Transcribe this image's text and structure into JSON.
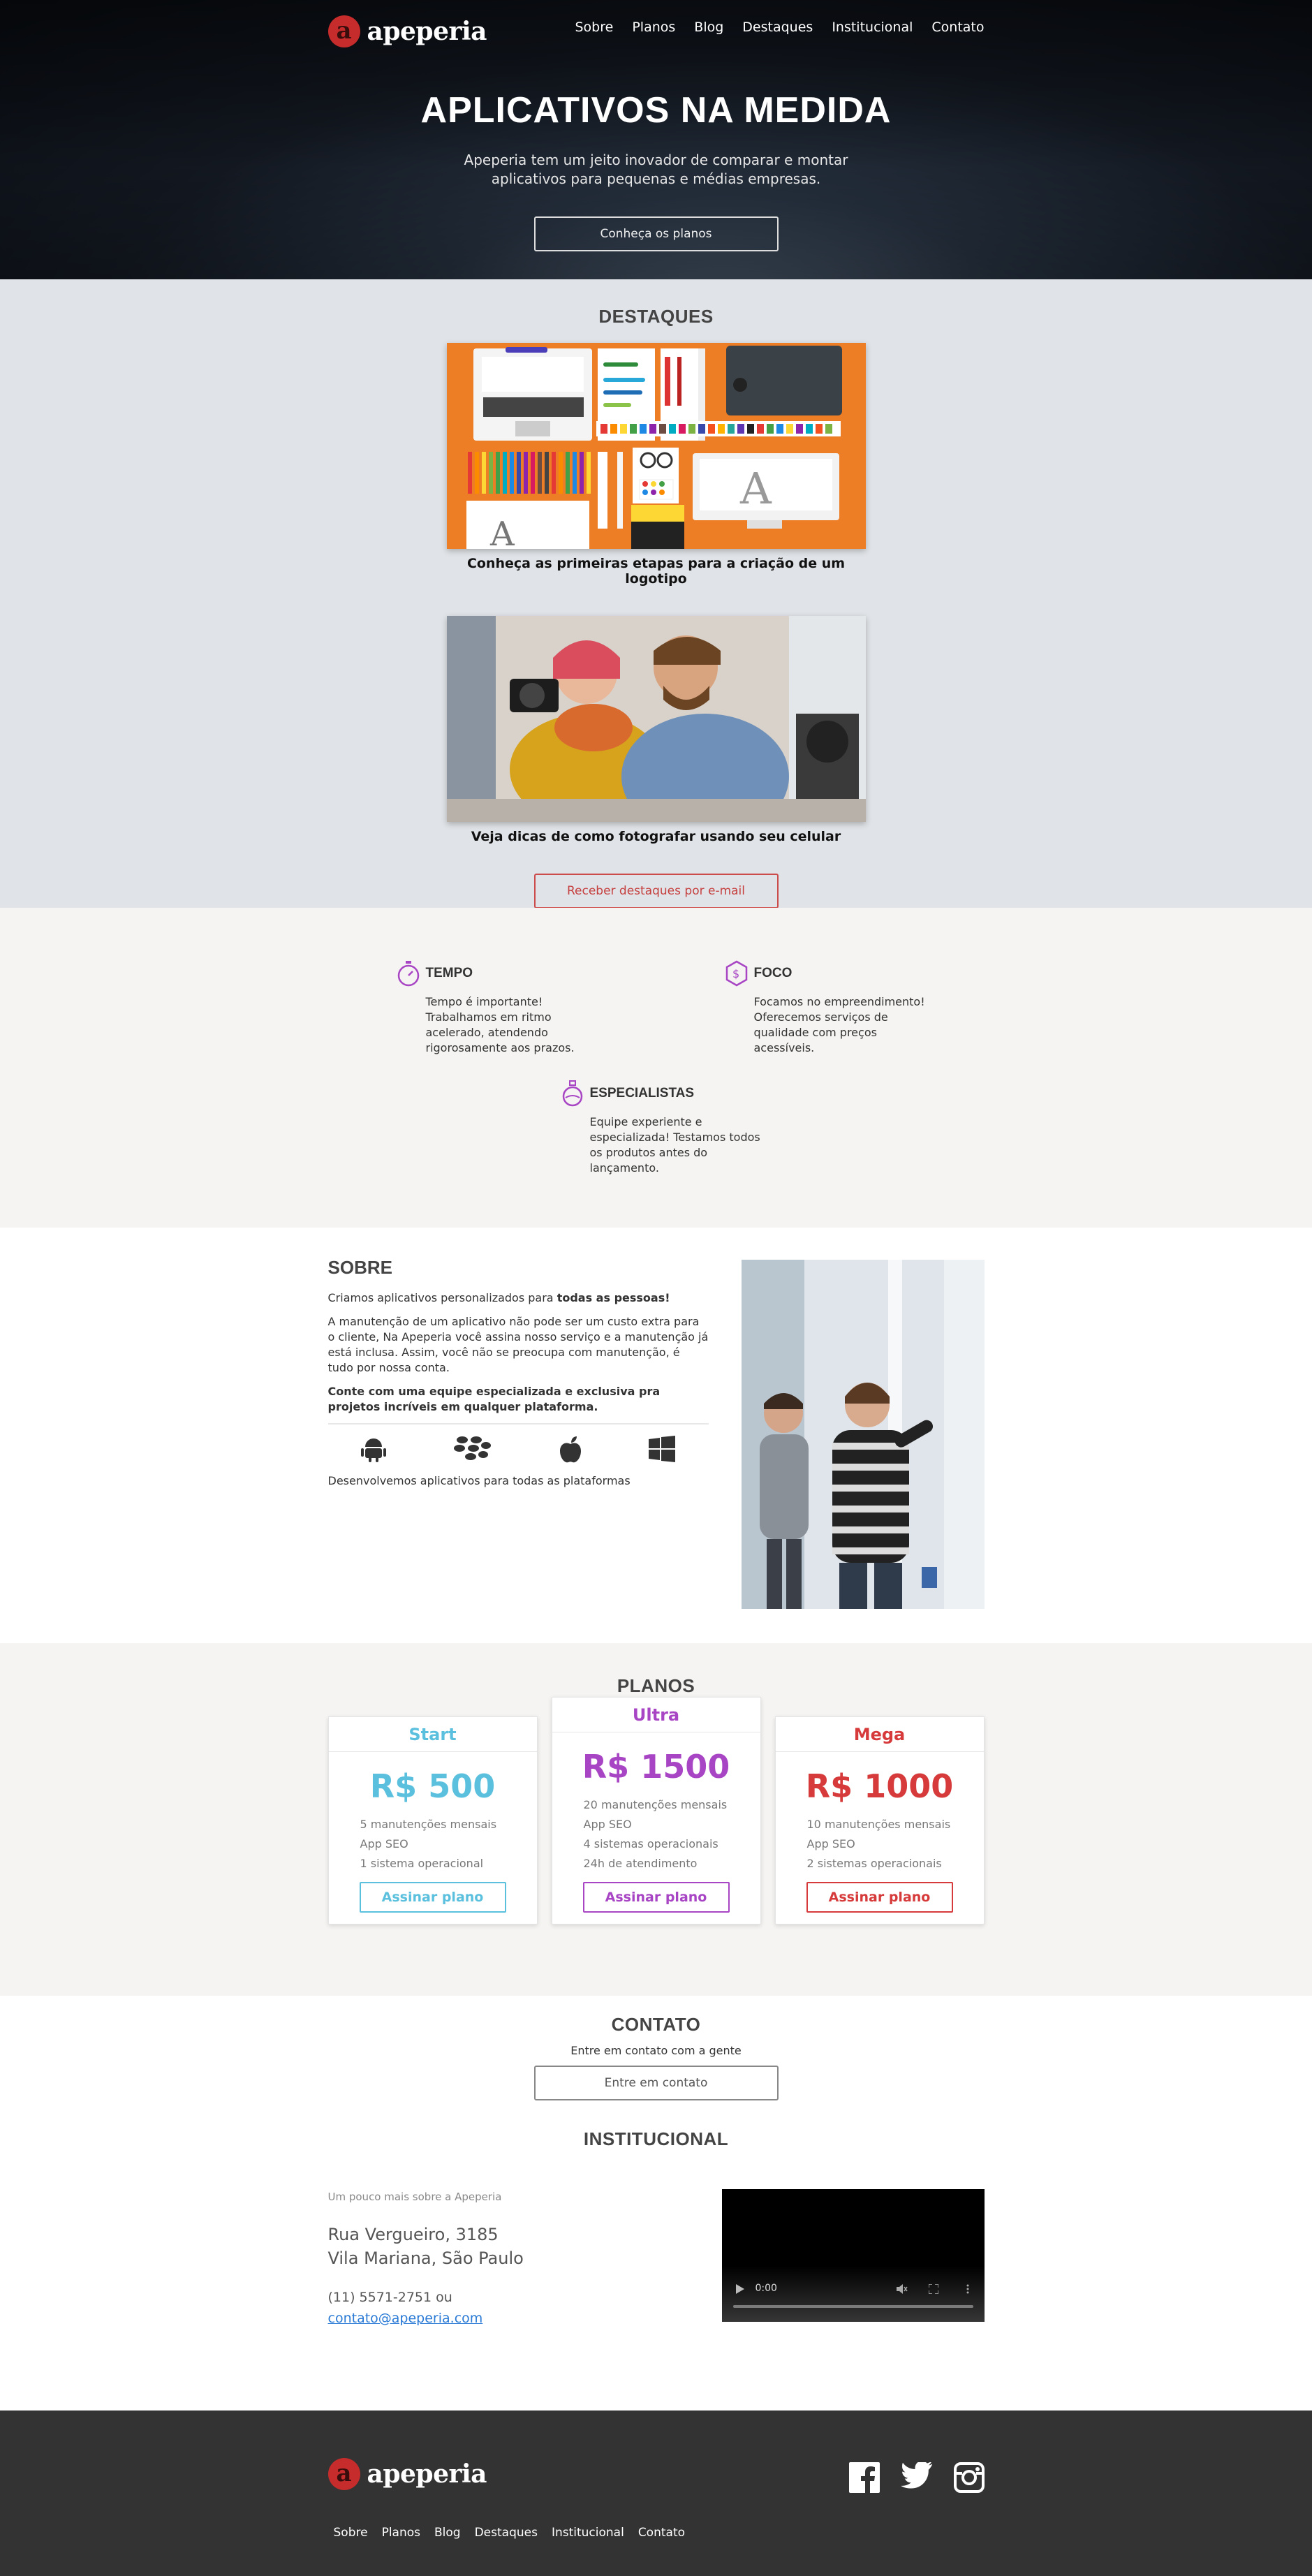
{
  "brand": {
    "logo_letter": "a",
    "name": "apeperia",
    "accent": "#c62c2c"
  },
  "nav": [
    "Sobre",
    "Planos",
    "Blog",
    "Destaques",
    "Institucional",
    "Contato"
  ],
  "hero": {
    "title": "APLICATIVOS NA MEDIDA",
    "subtitle": "Apeperia tem um jeito inovador de comparar e montar aplicativos para pequenas e médias empresas.",
    "button": "Conheça os planos"
  },
  "destaques": {
    "title": "DESTAQUES",
    "items": [
      {
        "caption": "Conheça as primeiras etapas para a criação de um logotipo"
      },
      {
        "caption": "Veja dicas de como fotografar usando seu celular"
      }
    ],
    "button": "Receber destaques por e-mail"
  },
  "features": [
    {
      "icon": "stopwatch-icon",
      "title": "TEMPO",
      "text": "Tempo é importante! Trabalhamos em ritmo acelerado, atendendo rigorosamente aos prazos."
    },
    {
      "icon": "dollar-hexagon-icon",
      "title": "FOCO",
      "text": "Focamos no empreendimento! Oferecemos serviços de qualidade com preços acessíveis."
    },
    {
      "icon": "flask-icon",
      "title": "ESPECIALISTAS",
      "text": "Equipe experiente e especializada! Testamos todos os produtos antes do lançamento."
    }
  ],
  "sobre": {
    "title": "SOBRE",
    "p1_start": "Criamos aplicativos personalizados para ",
    "p1_bold": "todas as pessoas!",
    "p2": "A manutenção de um aplicativo não pode ser um custo extra para o cliente, Na Apeperia você assina nosso serviço e a manutenção já está inclusa. Assim, você não se preocupa com manutenção, é tudo por nossa conta.",
    "p3": "Conte com uma equipe especializada e exclusiva pra projetos incríveis em qualquer plataforma.",
    "platforms": [
      "android-icon",
      "blackberry-icon",
      "apple-icon",
      "windows-icon"
    ],
    "platforms_text": "Desenvolvemos aplicativos para todas as plataformas"
  },
  "planos": {
    "title": "PLANOS",
    "plans": [
      {
        "name": "Start",
        "price": "R$ 500",
        "color": "#5bc0de",
        "features": [
          "5 manutenções mensais",
          "App SEO",
          "1 sistema operacional"
        ],
        "button": "Assinar plano"
      },
      {
        "name": "Ultra",
        "price": "R$ 1500",
        "color": "#a845c4",
        "features": [
          "20 manutenções mensais",
          "App SEO",
          "4 sistemas operacionais",
          "24h de atendimento"
        ],
        "button": "Assinar plano"
      },
      {
        "name": "Mega",
        "price": "R$ 1000",
        "color": "#d63a3a",
        "features": [
          "10 manutenções mensais",
          "App SEO",
          "2 sistemas operacionais"
        ],
        "button": "Assinar plano"
      }
    ]
  },
  "contato": {
    "title": "CONTATO",
    "text": "Entre em contato com a gente",
    "button": "Entre em contato"
  },
  "institucional": {
    "title": "INSTITUCIONAL",
    "intro": "Um pouco mais sobre a Apeperia",
    "address_line1": "Rua Vergueiro, 3185",
    "address_line2": "Vila Mariana, São Paulo",
    "phone": "(11) 5571-2751 ou",
    "email": "contato@apeperia.com",
    "video_time": "0:00"
  },
  "footer": {
    "social": [
      "facebook-icon",
      "twitter-icon",
      "instagram-icon"
    ],
    "nav": [
      "Sobre",
      "Planos",
      "Blog",
      "Destaques",
      "Institucional",
      "Contato"
    ]
  }
}
